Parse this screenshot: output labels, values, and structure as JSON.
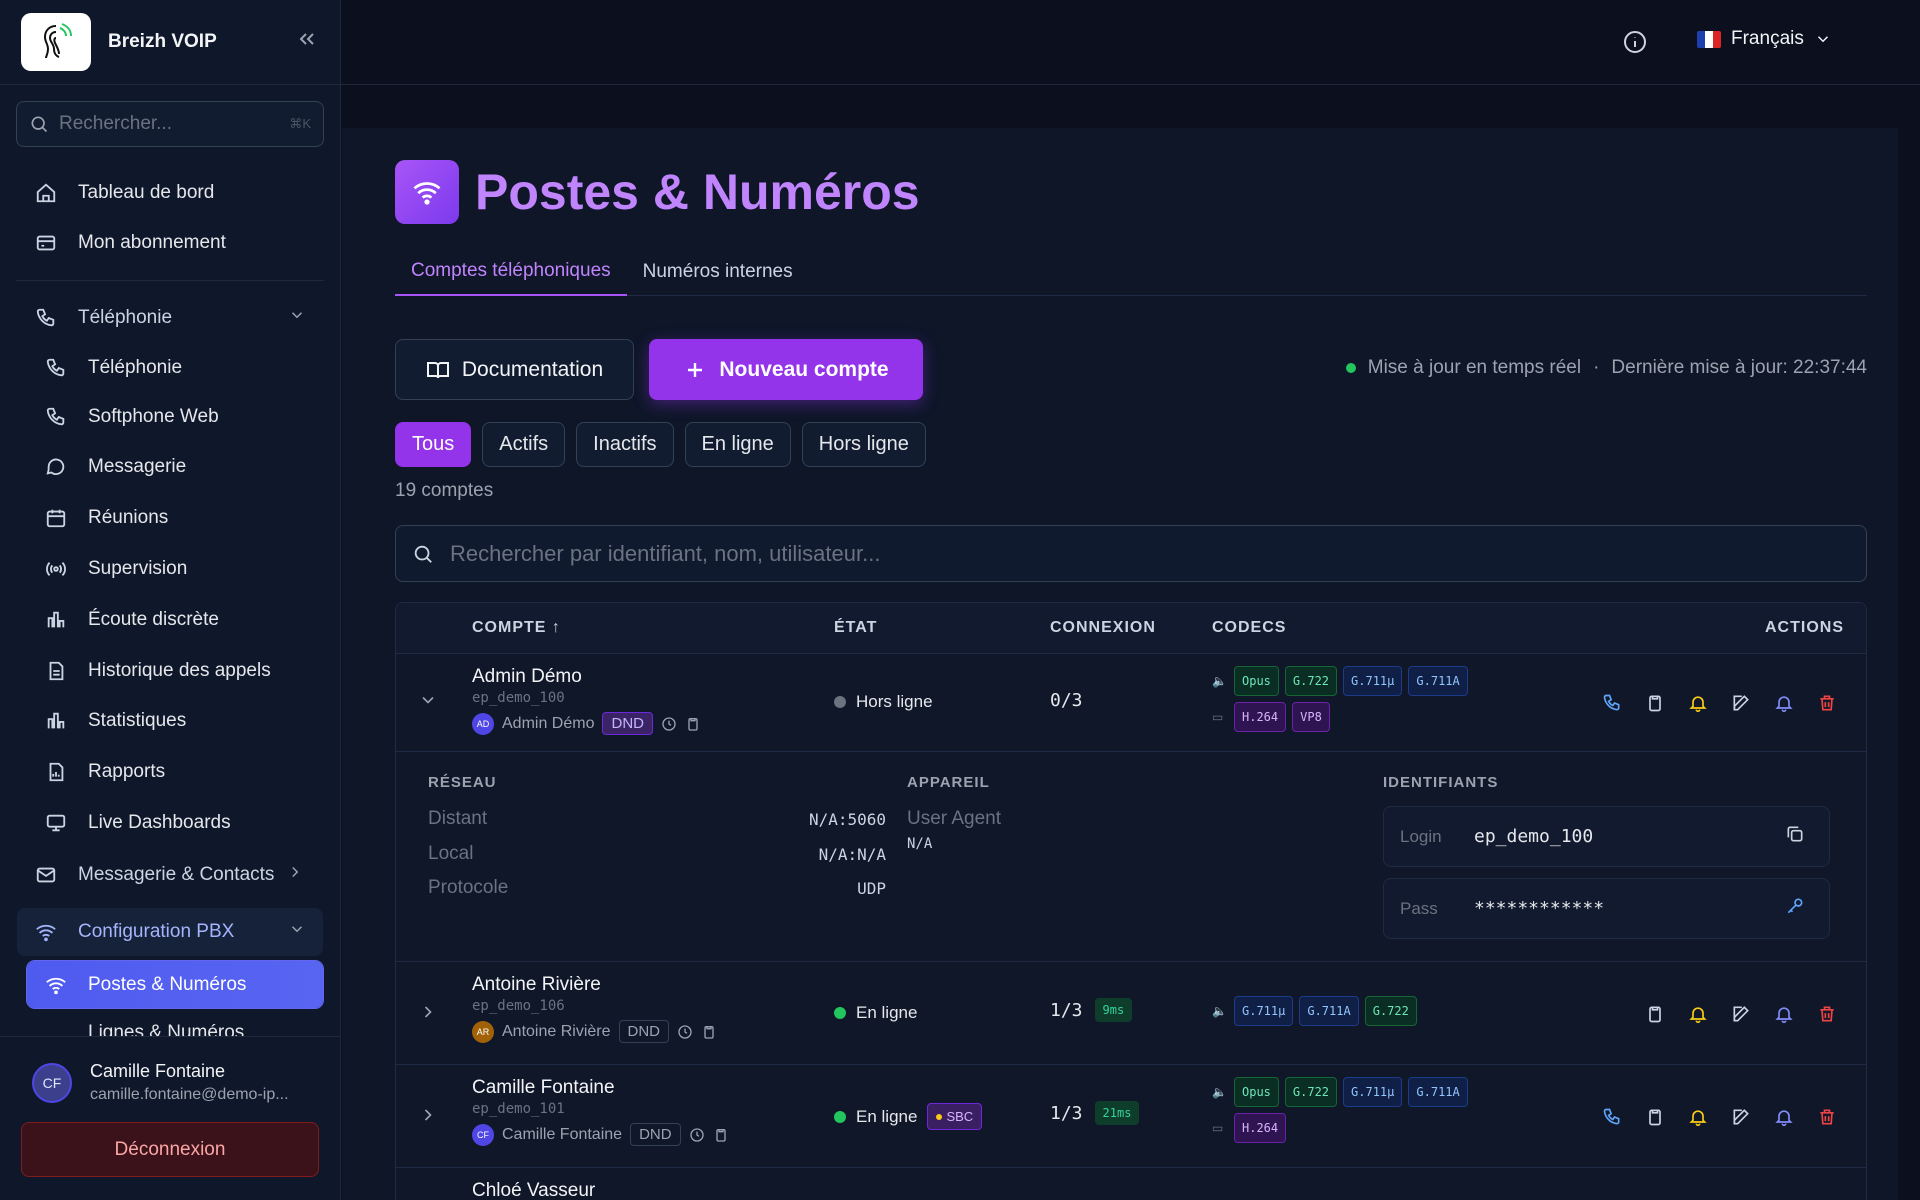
{
  "brand": {
    "name": "Breizh VOIP"
  },
  "sidebar": {
    "search_placeholder": "Rechercher...",
    "search_shortcut": "⌘K",
    "items": [
      {
        "label": "Tableau de bord"
      },
      {
        "label": "Mon abonnement"
      },
      {
        "label": "Téléphonie"
      },
      {
        "label": "Téléphonie"
      },
      {
        "label": "Softphone Web"
      },
      {
        "label": "Messagerie"
      },
      {
        "label": "Réunions"
      },
      {
        "label": "Supervision"
      },
      {
        "label": "Écoute discrète"
      },
      {
        "label": "Historique des appels"
      },
      {
        "label": "Statistiques"
      },
      {
        "label": "Rapports"
      },
      {
        "label": "Live Dashboards"
      },
      {
        "label": "Messagerie & Contacts"
      },
      {
        "label": "Configuration PBX"
      },
      {
        "label": "Postes & Numéros"
      },
      {
        "label": "Lignes & Numéros"
      }
    ],
    "user": {
      "initials": "CF",
      "name": "Camille Fontaine",
      "email": "camille.fontaine@demo-ip..."
    },
    "logout_label": "Déconnexion"
  },
  "topbar": {
    "language": "Français"
  },
  "page": {
    "title": "Postes & Numéros",
    "tabs": [
      "Comptes téléphoniques",
      "Numéros internes"
    ],
    "doc_button": "Documentation",
    "new_button": "Nouveau compte",
    "realtime": "Mise à jour en temps réel",
    "last_update": "Dernière mise à jour: 22:37:44",
    "filters": [
      "Tous",
      "Actifs",
      "Inactifs",
      "En ligne",
      "Hors ligne"
    ],
    "count": "19 comptes",
    "search_placeholder": "Rechercher par identifiant, nom, utilisateur..."
  },
  "table": {
    "headers": {
      "compte": "COMPTE ↑",
      "etat": "ÉTAT",
      "connexion": "CONNEXION",
      "codecs": "CODECS",
      "actions": "ACTIONS"
    },
    "rows": [
      {
        "name": "Admin Démo",
        "id": "ep_demo_100",
        "user_initials": "AD",
        "user": "Admin Démo",
        "dnd": "DND",
        "state": "Hors ligne",
        "conn": "0/3",
        "audio": [
          "Opus",
          "G.722",
          "G.711µ",
          "G.711A"
        ],
        "video": [
          "H.264",
          "VP8"
        ]
      },
      {
        "name": "Antoine Rivière",
        "id": "ep_demo_106",
        "user_initials": "AR",
        "user": "Antoine Rivière",
        "dnd": "DND",
        "state": "En ligne",
        "conn": "1/3",
        "latency": "9ms",
        "audio": [
          "G.711µ",
          "G.711A",
          "G.722"
        ]
      },
      {
        "name": "Camille Fontaine",
        "id": "ep_demo_101",
        "user_initials": "CF",
        "user": "Camille Fontaine",
        "dnd": "DND",
        "state": "En ligne",
        "sbc": "SBC",
        "conn": "1/3",
        "latency": "21ms",
        "audio": [
          "Opus",
          "G.722",
          "G.711µ",
          "G.711A"
        ],
        "video": [
          "H.264"
        ]
      },
      {
        "name": "Chloé Vasseur"
      }
    ]
  },
  "details": {
    "reseau": {
      "title": "RÉSEAU",
      "distant_label": "Distant",
      "distant": "N/A:5060",
      "local_label": "Local",
      "local": "N/A:N/A",
      "proto_label": "Protocole",
      "proto": "UDP"
    },
    "appareil": {
      "title": "APPAREIL",
      "ua_label": "User Agent",
      "ua": "N/A"
    },
    "identifiants": {
      "title": "IDENTIFIANTS",
      "login_label": "Login",
      "login": "ep_demo_100",
      "pass_label": "Pass",
      "pass": "************"
    }
  }
}
